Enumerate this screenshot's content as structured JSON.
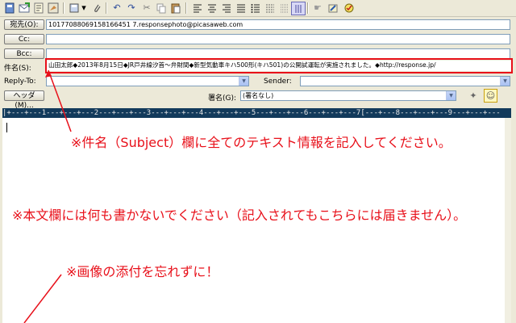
{
  "toolbar": {
    "icons": [
      "address-book-icon",
      "send-icon",
      "draft-icon",
      "sign-icon",
      "save-menu-icon",
      "attach-icon",
      "undo-icon",
      "redo-icon",
      "cut-icon",
      "copy-icon",
      "paste-icon",
      "align-left-icon",
      "align-center-icon",
      "align-right-icon",
      "list-icon",
      "grid-icon",
      "hand-icon",
      "pen-icon",
      "spell-check-icon"
    ]
  },
  "header": {
    "to_label": "宛先(O):",
    "to_value": "10177088069158166451 7.responsephoto@picasaweb.com",
    "cc_label": "Cc:",
    "bcc_label": "Bcc:",
    "subject_label": "件名(S):",
    "subject_value": "山田太郎◆2013年8月15日◆JR戸井線汐首～弁財間◆新型気動車キハ500形(キハ501)の公開試運転が実施されました。◆http://response.jp/",
    "replyto_label": "Reply-To:",
    "sender_label": "Sender:",
    "header_button_label": "ヘッダ(M)...",
    "signature_label": "署名(G):",
    "signature_value": "(署名なし)"
  },
  "ruler": {
    "text": "|+---+---1---+---+---2---+---+---3---+---+---4---+---+---5---+---+---6---+---+---7[---+---8---+---+---9---+---+---"
  },
  "notes": {
    "subject_note": "※件名（Subject）欄に全てのテキスト情報を記入してください。",
    "body_note": "※本文欄には何も書かないでください（記入されてもこちらには届きません）。",
    "attach_note": "※画像の添付を忘れずに！"
  },
  "colors": {
    "annotation": "#e8101a",
    "ruler_bg": "#123a5b",
    "window_bg": "#ece9d8"
  }
}
